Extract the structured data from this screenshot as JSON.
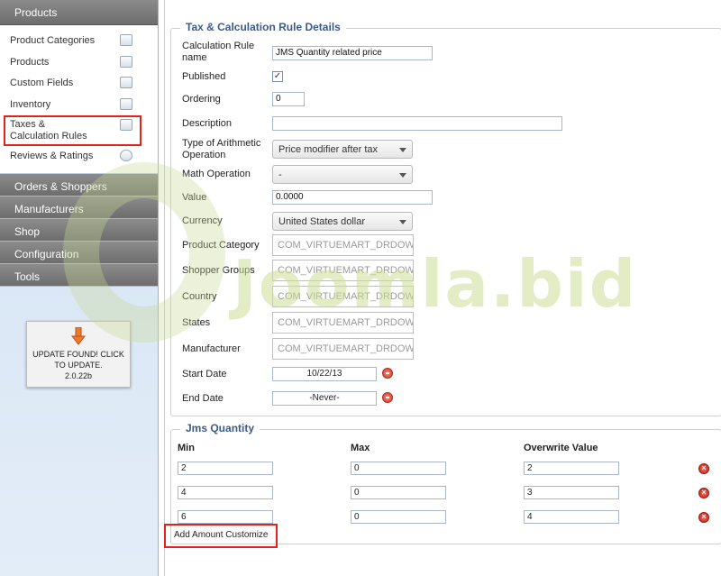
{
  "sidebar": {
    "header": "Products",
    "sub_items": [
      {
        "label": "Product Categories",
        "icon": "folder-icon"
      },
      {
        "label": "Products",
        "icon": "camera-icon"
      },
      {
        "label": "Custom Fields",
        "icon": "edit-icon"
      },
      {
        "label": "Inventory",
        "icon": "chart-icon"
      },
      {
        "label": "Taxes & Calculation Rules",
        "icon": "calculator-icon"
      },
      {
        "label": "Reviews & Ratings",
        "icon": "speech-bubble-icon"
      }
    ],
    "menus": [
      "Orders & Shoppers",
      "Manufacturers",
      "Shop",
      "Configuration",
      "Tools"
    ],
    "update": {
      "line1": "UPDATE FOUND! CLICK",
      "line2": "TO UPDATE.",
      "line3": "2.0.22b"
    }
  },
  "tax_form": {
    "legend": "Tax & Calculation Rule Details",
    "fields": {
      "name_label": "Calculation Rule name",
      "name_value": "JMS Quantity related price",
      "published_label": "Published",
      "published_checked": true,
      "ordering_label": "Ordering",
      "ordering_value": "0",
      "description_label": "Description",
      "description_value": "",
      "arith_label": "Type of Arithmetic Operation",
      "arith_value": "Price modifier after tax",
      "math_label": "Math Operation",
      "math_value": "-",
      "value_label": "Value",
      "value_value": "0.0000",
      "currency_label": "Currency",
      "currency_value": "United States dollar",
      "product_category_label": "Product Category",
      "product_category_value": "COM_VIRTUEMART_DRDOWN",
      "shopper_groups_label": "Shopper Groups",
      "shopper_groups_value": "COM_VIRTUEMART_DRDOWN",
      "country_label": "Country",
      "country_value": "COM_VIRTUEMART_DRDOWN",
      "states_label": "States",
      "states_value": "COM_VIRTUEMART_DRDOWN",
      "manufacturer_label": "Manufacturer",
      "manufacturer_value": "COM_VIRTUEMART_DRDOWN",
      "start_date_label": "Start Date",
      "start_date_value": "10/22/13",
      "end_date_label": "End Date",
      "end_date_value": "-Never-"
    }
  },
  "jms": {
    "legend": "Jms Quantity",
    "headers": {
      "min": "Min",
      "max": "Max",
      "overwrite": "Overwrite Value"
    },
    "rows": [
      {
        "min": "2",
        "max": "0",
        "overwrite": "2"
      },
      {
        "min": "4",
        "max": "0",
        "overwrite": "3"
      },
      {
        "min": "6",
        "max": "0",
        "overwrite": "4"
      }
    ],
    "add_button": "Add Amount Customize"
  },
  "watermark": "Joomla.bid"
}
